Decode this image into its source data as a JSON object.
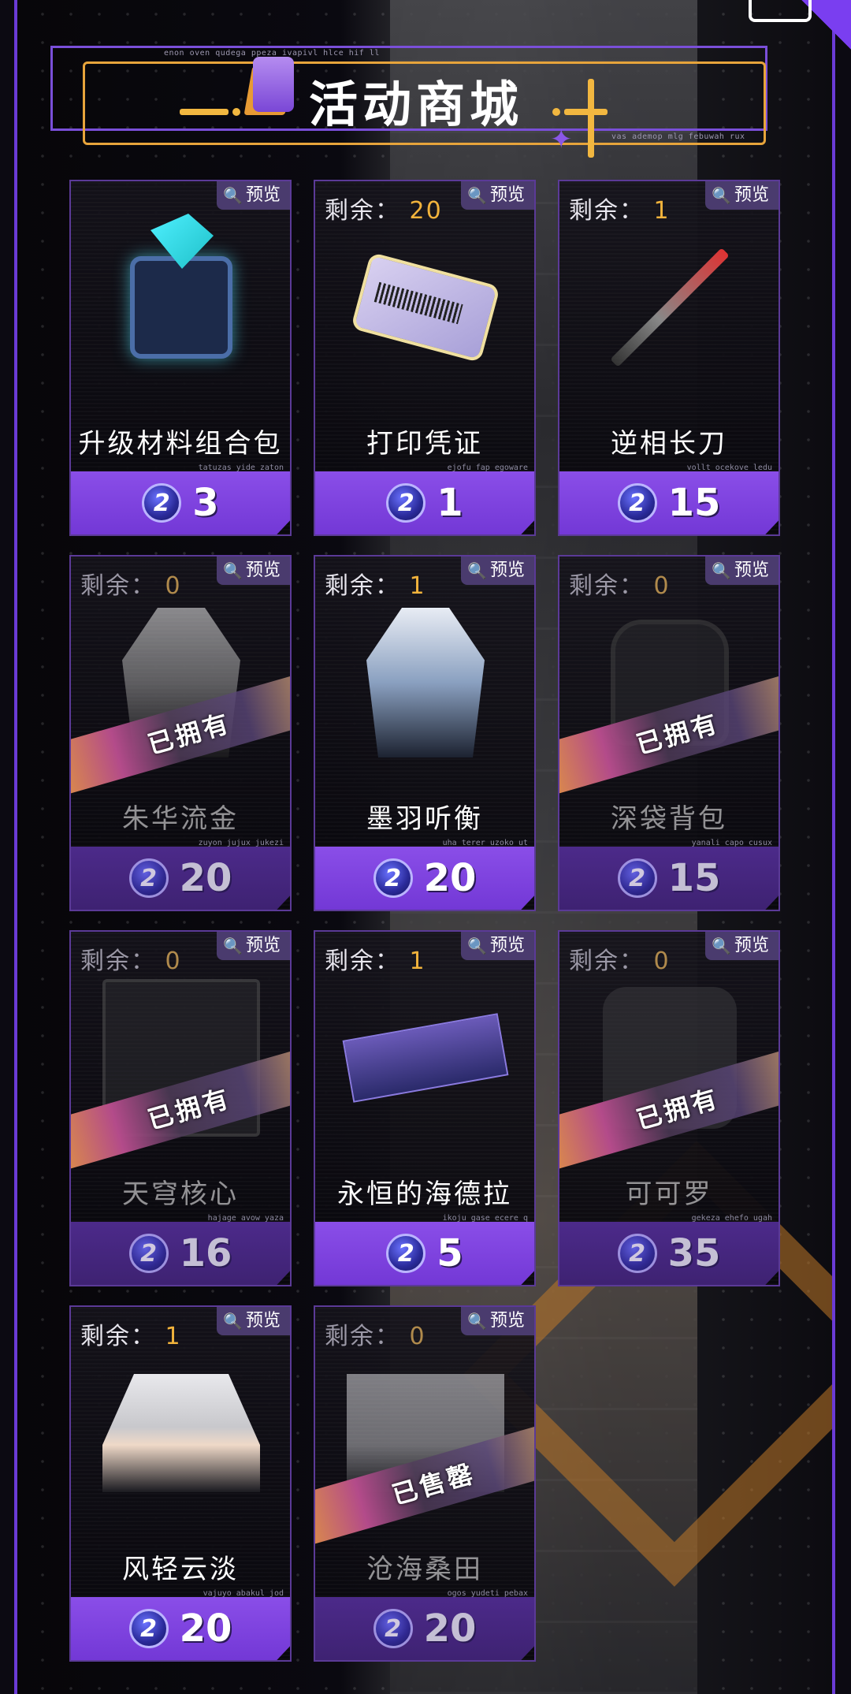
{
  "header": {
    "title": "活动商城",
    "tiny_text_top": "enon oven qudega ppeza ivapivl hlce hif ll",
    "tiny_text_bottom": "vas ademop mlg febuwah rux"
  },
  "labels": {
    "preview": "预览",
    "stock_prefix": "剩余：",
    "owned": "已拥有",
    "sold_out": "已售罄",
    "coin_symbol": "2"
  },
  "items": [
    {
      "name": "升级材料组合包",
      "sub": "tatuzas yide zaton",
      "stock": "",
      "price": "3",
      "state": "available"
    },
    {
      "name": "打印凭证",
      "sub": "ejofu fap egoware",
      "stock": "20",
      "price": "1",
      "state": "available"
    },
    {
      "name": "逆相长刀",
      "sub": "vollt ocekove ledu",
      "stock": "1",
      "price": "15",
      "state": "available"
    },
    {
      "name": "朱华流金",
      "sub": "zuyon jujux jukezi",
      "stock": "0",
      "price": "20",
      "state": "owned"
    },
    {
      "name": "墨羽听衡",
      "sub": "uha terer uzoko ut",
      "stock": "1",
      "price": "20",
      "state": "available"
    },
    {
      "name": "深袋背包",
      "sub": "yanali capo cusux",
      "stock": "0",
      "price": "15",
      "state": "owned"
    },
    {
      "name": "天穹核心",
      "sub": "hajage avow yaza",
      "stock": "0",
      "price": "16",
      "state": "owned"
    },
    {
      "name": "永恒的海德拉",
      "sub": "ikoju gase ecere q",
      "stock": "1",
      "price": "5",
      "state": "available"
    },
    {
      "name": "可可罗",
      "sub": "gekeza ehefo ugah",
      "stock": "0",
      "price": "35",
      "state": "owned"
    },
    {
      "name": "风轻云淡",
      "sub": "vajuyo abakul jod",
      "stock": "1",
      "price": "20",
      "state": "available"
    },
    {
      "name": "沧海桑田",
      "sub": "ogos yudeti pebax",
      "stock": "0",
      "price": "20",
      "state": "sold_out"
    }
  ]
}
